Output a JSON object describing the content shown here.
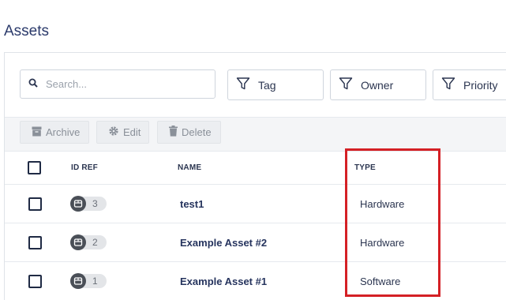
{
  "page": {
    "title": "Assets"
  },
  "search": {
    "placeholder": "Search..."
  },
  "filters": [
    {
      "label": "Tag",
      "icon": "filter-icon"
    },
    {
      "label": "Owner",
      "icon": "filter-icon"
    },
    {
      "label": "Priority",
      "icon": "filter-icon"
    }
  ],
  "actions": {
    "archive": "Archive",
    "edit": "Edit",
    "delete": "Delete"
  },
  "table": {
    "columns": {
      "id_ref": "ID REF",
      "name": "NAME",
      "type": "TYPE"
    },
    "rows": [
      {
        "id": "3",
        "name": "test1",
        "type": "Hardware"
      },
      {
        "id": "2",
        "name": "Example Asset #2",
        "type": "Hardware"
      },
      {
        "id": "1",
        "name": "Example Asset #1",
        "type": "Software"
      }
    ]
  },
  "colors": {
    "title": "#2b3a6b",
    "highlight": "#d42025",
    "action_bar": "#f4f5f7"
  }
}
